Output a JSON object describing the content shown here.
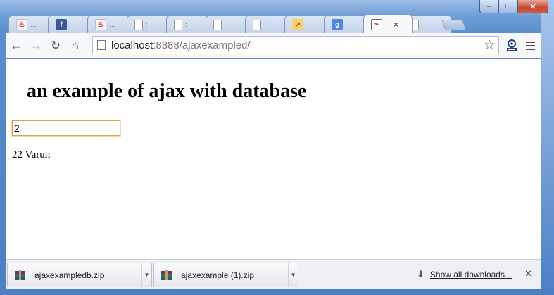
{
  "window": {
    "controls": {
      "minimize": "–",
      "maximize": "□",
      "close": "✕"
    }
  },
  "tabs": [
    {
      "icon": "java-icon",
      "glyph": "♨",
      "label": "…"
    },
    {
      "icon": "facebook-icon",
      "glyph": "f",
      "label": ""
    },
    {
      "icon": "java-icon",
      "glyph": "♨",
      "label": "…"
    },
    {
      "icon": "page-icon",
      "glyph": "",
      "label": ":"
    },
    {
      "icon": "page-icon",
      "glyph": "",
      "label": ":"
    },
    {
      "icon": "page-icon",
      "glyph": "",
      "label": ""
    },
    {
      "icon": "page-icon",
      "glyph": "",
      "label": ":"
    },
    {
      "icon": "chart-icon",
      "glyph": "↗",
      "label": ""
    },
    {
      "icon": "google-icon",
      "glyph": "g",
      "label": ""
    },
    {
      "icon": "image-icon",
      "glyph": "⌁",
      "label": "",
      "active": true,
      "close": "×"
    },
    {
      "icon": "page-icon",
      "glyph": "",
      "label": ""
    }
  ],
  "toolbar": {
    "back": "←",
    "forward": "→",
    "reload": "↻",
    "home": "⌂",
    "url_host": "localhost",
    "url_rest": ":8888/ajaxexampled/",
    "star": "☆"
  },
  "page": {
    "heading": "an example of ajax with database",
    "input_value": "2",
    "result": "22 Varun"
  },
  "downloads": {
    "items": [
      {
        "name": "ajaxexampledb.zip",
        "arrow": "▼"
      },
      {
        "name": "ajaxexample (1).zip",
        "arrow": "▼"
      }
    ],
    "show_all": "Show all downloads...",
    "download_glyph": "⬇",
    "close": "✕"
  },
  "colors": {
    "frame": "#5a8dcc",
    "input_focus": "#e1a33f"
  }
}
